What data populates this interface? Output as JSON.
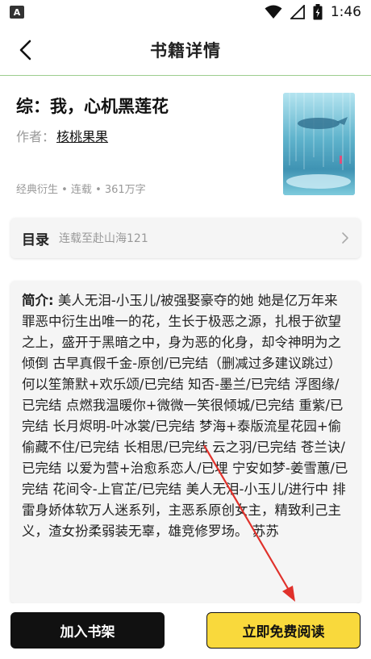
{
  "status_bar": {
    "app_badge": "A",
    "time": "1:46",
    "icons": [
      "wifi-icon",
      "signal-icon",
      "battery-icon"
    ]
  },
  "header": {
    "title": "书籍详情",
    "back_icon": "chevron-left-icon"
  },
  "book": {
    "title": "综：我，心机黑莲花",
    "author_label": "作者：",
    "author_name": "核桃果果",
    "meta": "经典衍生 • 连载 • 361万字"
  },
  "catalog": {
    "label": "目录",
    "status": "连载至赴山海121",
    "chevron_icon": "chevron-right-icon"
  },
  "intro": {
    "label": "简介:",
    "text": " 美人无泪-小玉儿/被强娶豪夺的她 她是亿万年来罪恶中衍生出唯一的花，生长于极恶之源，扎根于欲望之上，盛开于黑暗之中，身为恶的化身，却令神明为之倾倒 古早真假千金-原创/已完结（删减过多建议跳过） 何以笙箫默+欢乐颂/已完结 知否-墨兰/已完结 浮图缘/已完结 点燃我温暖你+微微一笑很倾城/已完结 重紫/已完结 长月烬明-叶冰裳/已完结 梦海+泰版流星花园+偷偷藏不住/已完结 长相思/已完结 云之羽/已完结 苍兰诀/已完结 以爱为营+治愈系恋人/已埋 宁安如梦-姜雪蕙/已完结 花间令-上官芷/已完结 美人无泪-小玉儿/进行中 排雷身娇体软万人迷系列，主恶系原创女主，精致利己主义，渣女扮柔弱装无辜，雄竞修罗场。 苏苏"
  },
  "bottom": {
    "add_shelf": "加入书架",
    "read_free": "立即免费阅读"
  },
  "colors": {
    "accent_yellow": "#f9d93c",
    "header_line": "#9ccd8e",
    "annotation_red": "#e0312b"
  }
}
